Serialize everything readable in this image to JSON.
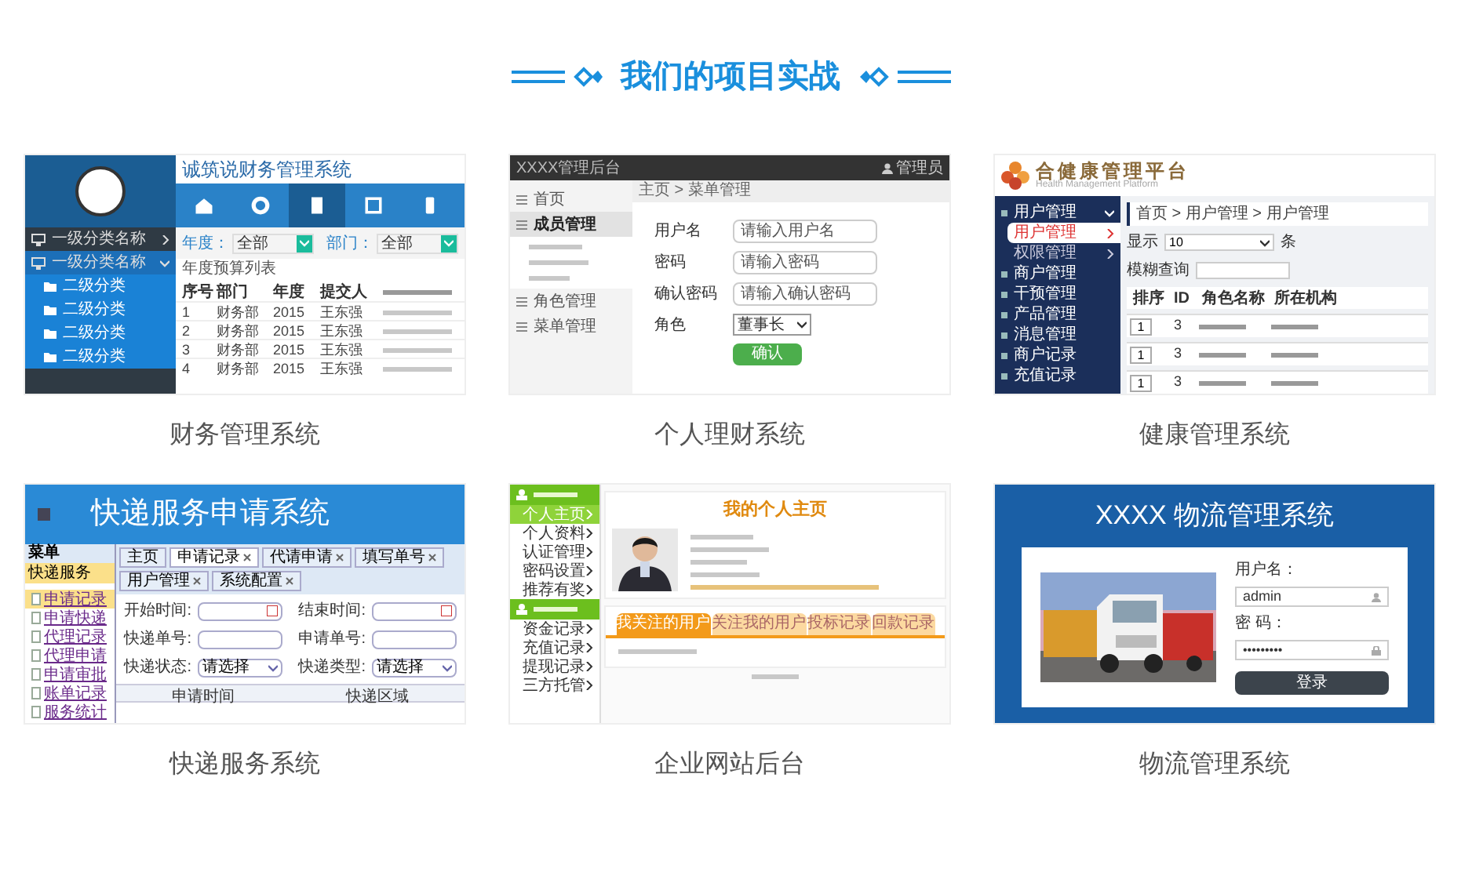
{
  "section_title": "我们的项目实战",
  "projects": [
    {
      "kind": "finance",
      "caption": "财务管理系统",
      "app": {
        "title": "诚筑说财务管理系统",
        "tools": [
          {
            "selected": false
          },
          {
            "selected": false
          },
          {
            "selected": true
          },
          {
            "selected": false
          },
          {
            "selected": false
          }
        ],
        "menu": [
          {
            "label": "一级分类名称",
            "expanded": false
          },
          {
            "label": "一级分类名称",
            "expanded": true,
            "children": [
              "二级分类",
              "二级分类",
              "二级分类",
              "二级分类"
            ]
          }
        ],
        "filters": [
          {
            "label": "年度：",
            "value": "全部"
          },
          {
            "label": "部门：",
            "value": "全部"
          }
        ],
        "list_title": "年度预算列表",
        "columns": [
          "序号",
          "部门",
          "年度",
          "提交人"
        ],
        "rows": [
          [
            "1",
            "财务部",
            "2015",
            "王东强"
          ],
          [
            "2",
            "财务部",
            "2015",
            "王东强"
          ],
          [
            "3",
            "财务部",
            "2015",
            "王东强"
          ],
          [
            "4",
            "财务部",
            "2015",
            "王东强"
          ]
        ]
      }
    },
    {
      "kind": "admin",
      "caption": "个人理财系统",
      "app": {
        "title": "XXXX管理后台",
        "user": "管理员",
        "menu": [
          {
            "label": "首页",
            "selected": false
          },
          {
            "label": "成员管理",
            "selected": true
          },
          {
            "label": "角色管理",
            "selected": false
          },
          {
            "label": "菜单管理",
            "selected": false
          }
        ],
        "breadcrumb": "主页 > 菜单管理",
        "fields": [
          {
            "label": "用户名",
            "placeholder": "请输入用户名"
          },
          {
            "label": "密码",
            "placeholder": "请输入密码"
          },
          {
            "label": "确认密码",
            "placeholder": "请输入确认密码"
          }
        ],
        "role_label": "角色",
        "role_value": "董事长",
        "submit": "确认"
      }
    },
    {
      "kind": "health",
      "caption": "健康管理系统",
      "app": {
        "title": "合健康管理平台",
        "subtitle": "Health Management Platform",
        "menu": [
          {
            "label": "用户管理",
            "expanded": true,
            "children": [
              {
                "label": "用户管理",
                "selected": true
              },
              {
                "label": "权限管理",
                "selected": false
              }
            ]
          },
          {
            "label": "商户管理",
            "expanded": false
          },
          {
            "label": "干预管理",
            "expanded": false
          },
          {
            "label": "产品管理",
            "expanded": false
          },
          {
            "label": "消息管理",
            "expanded": false
          },
          {
            "label": "商户记录",
            "expanded": false
          },
          {
            "label": "充值记录",
            "expanded": false
          }
        ],
        "breadcrumb": "首页 > 用户管理 > 用户管理",
        "show_label": "显示",
        "show_value": "10",
        "show_unit": "条",
        "search_label": "模糊查询",
        "columns": [
          "排序",
          "ID",
          "角色名称",
          "所在机构"
        ],
        "rows": [
          [
            "1",
            "3"
          ],
          [
            "1",
            "3"
          ],
          [
            "1",
            "3"
          ]
        ]
      }
    },
    {
      "kind": "express",
      "caption": "快递服务系统",
      "app": {
        "title": "快递服务申请系统",
        "menu_title": "菜单",
        "group": "快递服务",
        "links": [
          {
            "label": "申请记录",
            "selected": true
          },
          {
            "label": "申请快递",
            "selected": false
          },
          {
            "label": "代理记录",
            "selected": false
          },
          {
            "label": "代理申请",
            "selected": false
          },
          {
            "label": "申请审批",
            "selected": false
          },
          {
            "label": "账单记录",
            "selected": false
          },
          {
            "label": "服务统计",
            "selected": false
          }
        ],
        "tabs": [
          {
            "label": "主页",
            "selected": false,
            "closable": false
          },
          {
            "label": "申请记录",
            "selected": true,
            "closable": true
          },
          {
            "label": "代请申请",
            "selected": false,
            "closable": true
          },
          {
            "label": "填写单号",
            "selected": false,
            "closable": true
          },
          {
            "label": "用户管理",
            "selected": false,
            "closable": true
          },
          {
            "label": "系统配置",
            "selected": false,
            "closable": true
          }
        ],
        "fields": [
          {
            "label": "开始时间:",
            "kind": "date"
          },
          {
            "label": "结束时间:",
            "kind": "date"
          },
          {
            "label": "快递单号:",
            "kind": "text"
          },
          {
            "label": "申请单号:",
            "kind": "text"
          },
          {
            "label": "快递状态:",
            "kind": "select",
            "value": "请选择"
          },
          {
            "label": "快递类型:",
            "kind": "select",
            "value": "请选择"
          }
        ],
        "columns": [
          "申请时间",
          "快递区域"
        ]
      }
    },
    {
      "kind": "portal",
      "caption": "企业网站后台",
      "app": {
        "title": "我的个人主页",
        "groups": [
          {
            "items": [
              {
                "label": "个人主页",
                "selected": true
              },
              {
                "label": "个人资料",
                "selected": false
              },
              {
                "label": "认证管理",
                "selected": false
              },
              {
                "label": "密码设置",
                "selected": false
              },
              {
                "label": "推荐有奖",
                "selected": false
              }
            ]
          },
          {
            "items": [
              {
                "label": "资金记录",
                "selected": false
              },
              {
                "label": "充值记录",
                "selected": false
              },
              {
                "label": "提现记录",
                "selected": false
              },
              {
                "label": "三方托管",
                "selected": false
              }
            ]
          }
        ],
        "tabs": [
          {
            "label": "我关注的用户",
            "selected": true
          },
          {
            "label": "关注我的用户",
            "selected": false
          },
          {
            "label": "投标记录",
            "selected": false
          },
          {
            "label": "回款记录",
            "selected": false
          }
        ]
      }
    },
    {
      "kind": "logistics",
      "caption": "物流管理系统",
      "app": {
        "title": "XXXX 物流管理系统",
        "user_label": "用户名：",
        "user_value": "admin",
        "pass_label": "密 码：",
        "pass_value": "•••••••••",
        "submit": "登录"
      }
    }
  ]
}
